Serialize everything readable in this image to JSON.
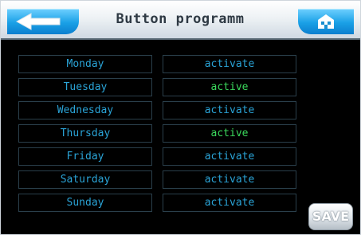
{
  "header": {
    "title": "Button programm",
    "back_icon": "arrow-left-icon",
    "home_icon": "home-icon",
    "accent": "#1aa0e6"
  },
  "days": [
    {
      "day": "Monday",
      "status": "activate"
    },
    {
      "day": "Tuesday",
      "status": "active"
    },
    {
      "day": "Wednesday",
      "status": "activate"
    },
    {
      "day": "Thursday",
      "status": "active"
    },
    {
      "day": "Friday",
      "status": "activate"
    },
    {
      "day": "Saturday",
      "status": "activate"
    },
    {
      "day": "Sunday",
      "status": "activate"
    }
  ],
  "colors": {
    "day_text": "#2aa3d6",
    "inactive_text": "#2aa3d6",
    "active_text": "#3bd85c"
  },
  "footer": {
    "save_label": "SAVE"
  }
}
